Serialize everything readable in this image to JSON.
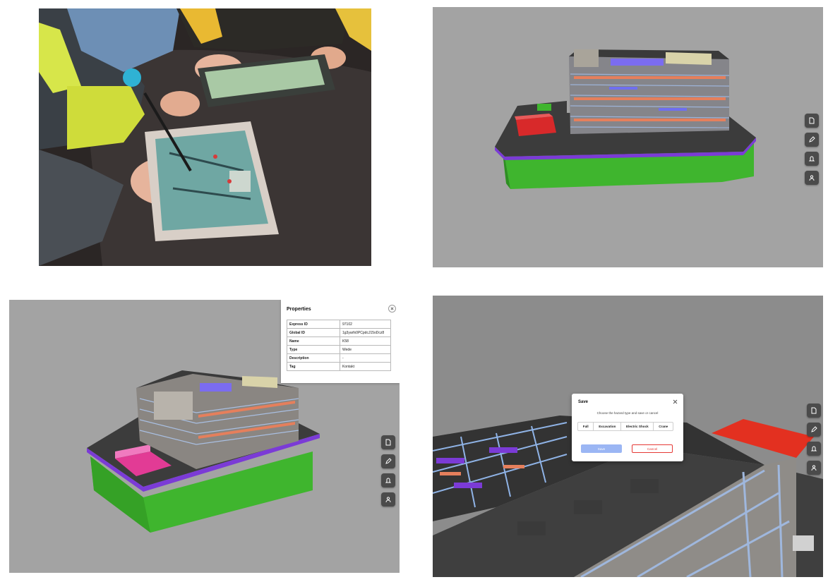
{
  "panels": {
    "photo": {
      "description_icon": "tablet-photo"
    },
    "viewer_toolbar": {
      "icons": [
        "document-icon",
        "pencil-icon",
        "bell-icon",
        "person-icon"
      ]
    }
  },
  "properties": {
    "title": "Properties",
    "rows": [
      {
        "key": "Express ID",
        "value": "97102"
      },
      {
        "key": "Global ID",
        "value": "1g3yarfx0PCpdcJ15oDcz8"
      },
      {
        "key": "Name",
        "value": "K58"
      },
      {
        "key": "Type",
        "value": "Wede"
      },
      {
        "key": "Description",
        "value": "-"
      },
      {
        "key": "Tag",
        "value": "Kontakt"
      }
    ]
  },
  "save_dialog": {
    "title": "Save",
    "prompt": "Choose the hazard type and save or cancel",
    "hazards": [
      "Fall",
      "Excavation",
      "Electric Shock",
      "Crane"
    ],
    "save_label": "Save",
    "cancel_label": "Cancel"
  },
  "colors": {
    "viewer_bg": "#a3a3a3",
    "toolbar_btn": "#4b4b4b",
    "save_btn": "#9bb6f4",
    "cancel_border": "#e53935",
    "model_green": "#3fb52e",
    "model_purple": "#7b3bd6",
    "model_red": "#d8292a",
    "model_magenta": "#e23b95"
  }
}
